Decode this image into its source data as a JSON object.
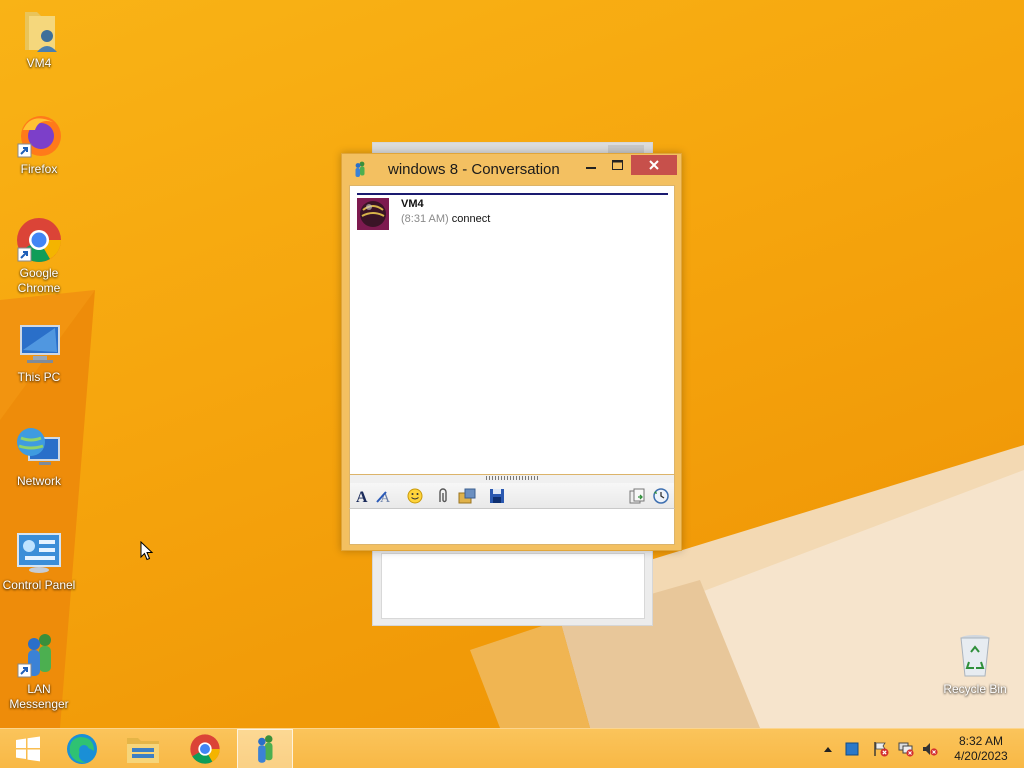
{
  "desktop": {
    "icons": [
      {
        "id": "vm4",
        "label": "VM4"
      },
      {
        "id": "firefox",
        "label": "Firefox"
      },
      {
        "id": "chrome",
        "label": "Google Chrome"
      },
      {
        "id": "this-pc",
        "label": "This PC"
      },
      {
        "id": "network",
        "label": "Network"
      },
      {
        "id": "control-panel",
        "label": "Control Panel"
      },
      {
        "id": "lan-messenger",
        "label": "LAN Messenger"
      },
      {
        "id": "recycle-bin",
        "label": "Recycle Bin"
      }
    ]
  },
  "conversation": {
    "title": "windows 8 - Conversation",
    "messages": [
      {
        "sender": "VM4",
        "time": "(8:31 AM)",
        "text": "connect"
      }
    ],
    "input_value": ""
  },
  "taskbar": {
    "apps": [
      "start-button",
      "edge",
      "file-explorer",
      "chrome",
      "lan-messenger"
    ],
    "active_app": "lan-messenger",
    "clock": {
      "time": "8:32 AM",
      "date": "4/20/2023"
    }
  },
  "colors": {
    "desktop_bg": "#f6a20a",
    "window_frame": "#f3c061",
    "close_button": "#c7504b",
    "taskbar": "#f8b845"
  }
}
